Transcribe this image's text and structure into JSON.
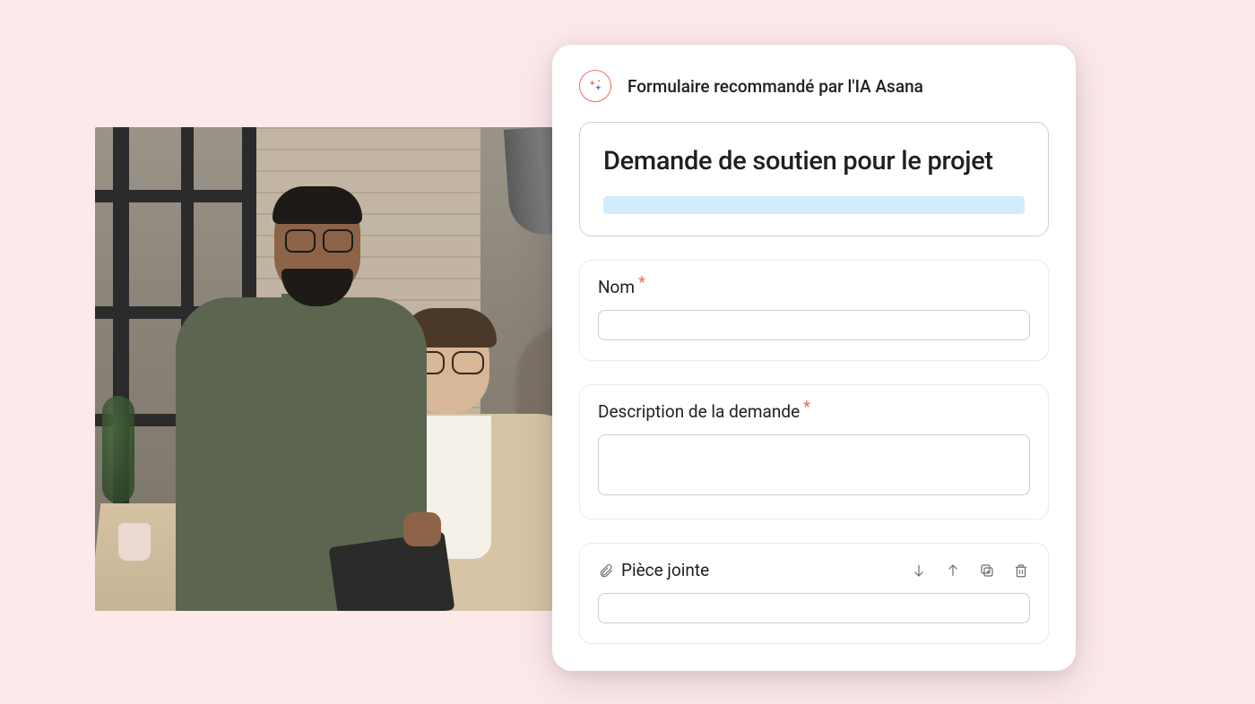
{
  "header": {
    "title": "Formulaire recommandé par l'IA Asana"
  },
  "form": {
    "title": "Demande de soutien pour le projet",
    "fields": {
      "name": {
        "label": "Nom",
        "required": true,
        "value": ""
      },
      "description": {
        "label": "Description de la demande",
        "required": true,
        "value": ""
      },
      "attachment": {
        "label": "Pièce jointe",
        "value": ""
      }
    }
  },
  "icons": {
    "ai_sparkle": "ai-sparkle-icon",
    "paperclip": "paperclip-icon",
    "move_down": "arrow-down-icon",
    "move_up": "arrow-up-icon",
    "duplicate": "duplicate-icon",
    "delete": "trash-icon"
  }
}
